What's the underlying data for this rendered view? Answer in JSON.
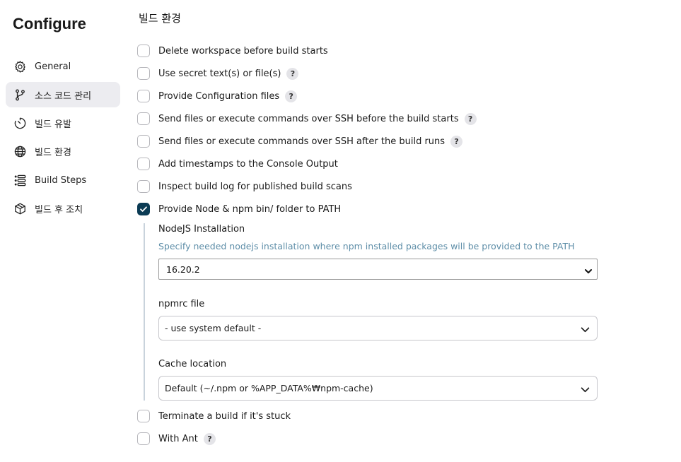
{
  "page": {
    "title": "Configure"
  },
  "sidebar": {
    "items": [
      {
        "label": "General",
        "icon": "gear-icon",
        "active": false
      },
      {
        "label": "소스 코드 관리",
        "icon": "branch-icon",
        "active": true
      },
      {
        "label": "빌드 유발",
        "icon": "timer-icon",
        "active": false
      },
      {
        "label": "빌드 환경",
        "icon": "globe-icon",
        "active": false
      },
      {
        "label": "Build Steps",
        "icon": "list-icon",
        "active": false
      },
      {
        "label": "빌드 후 조치",
        "icon": "package-icon",
        "active": false
      }
    ]
  },
  "main": {
    "section_title": "빌드 환경",
    "options": [
      {
        "label": "Delete workspace before build starts",
        "checked": false,
        "help": false
      },
      {
        "label": "Use secret text(s) or file(s)",
        "checked": false,
        "help": true
      },
      {
        "label": "Provide Configuration files",
        "checked": false,
        "help": true
      },
      {
        "label": "Send files or execute commands over SSH before the build starts",
        "checked": false,
        "help": true
      },
      {
        "label": "Send files or execute commands over SSH after the build runs",
        "checked": false,
        "help": true
      },
      {
        "label": "Add timestamps to the Console Output",
        "checked": false,
        "help": false
      },
      {
        "label": "Inspect build log for published build scans",
        "checked": false,
        "help": false
      },
      {
        "label": "Provide Node & npm bin/ folder to PATH",
        "checked": true,
        "help": false
      },
      {
        "label": "Terminate a build if it's stuck",
        "checked": false,
        "help": false
      },
      {
        "label": "With Ant",
        "checked": false,
        "help": true
      }
    ],
    "help_glyph": "?",
    "node": {
      "installation_label": "NodeJS Installation",
      "installation_desc": "Specify needed nodejs installation where npm installed packages will be provided to the PATH",
      "installation_value": "16.20.2",
      "npmrc_label": "npmrc file",
      "npmrc_value": "- use system default -",
      "cache_label": "Cache location",
      "cache_value": "Default (~/.npm or %APP_DATA%₩npm-cache)"
    }
  },
  "colors": {
    "accent": "#0b3b54",
    "active_nav_bg": "#ececf0",
    "description": "#5e8ea8"
  }
}
